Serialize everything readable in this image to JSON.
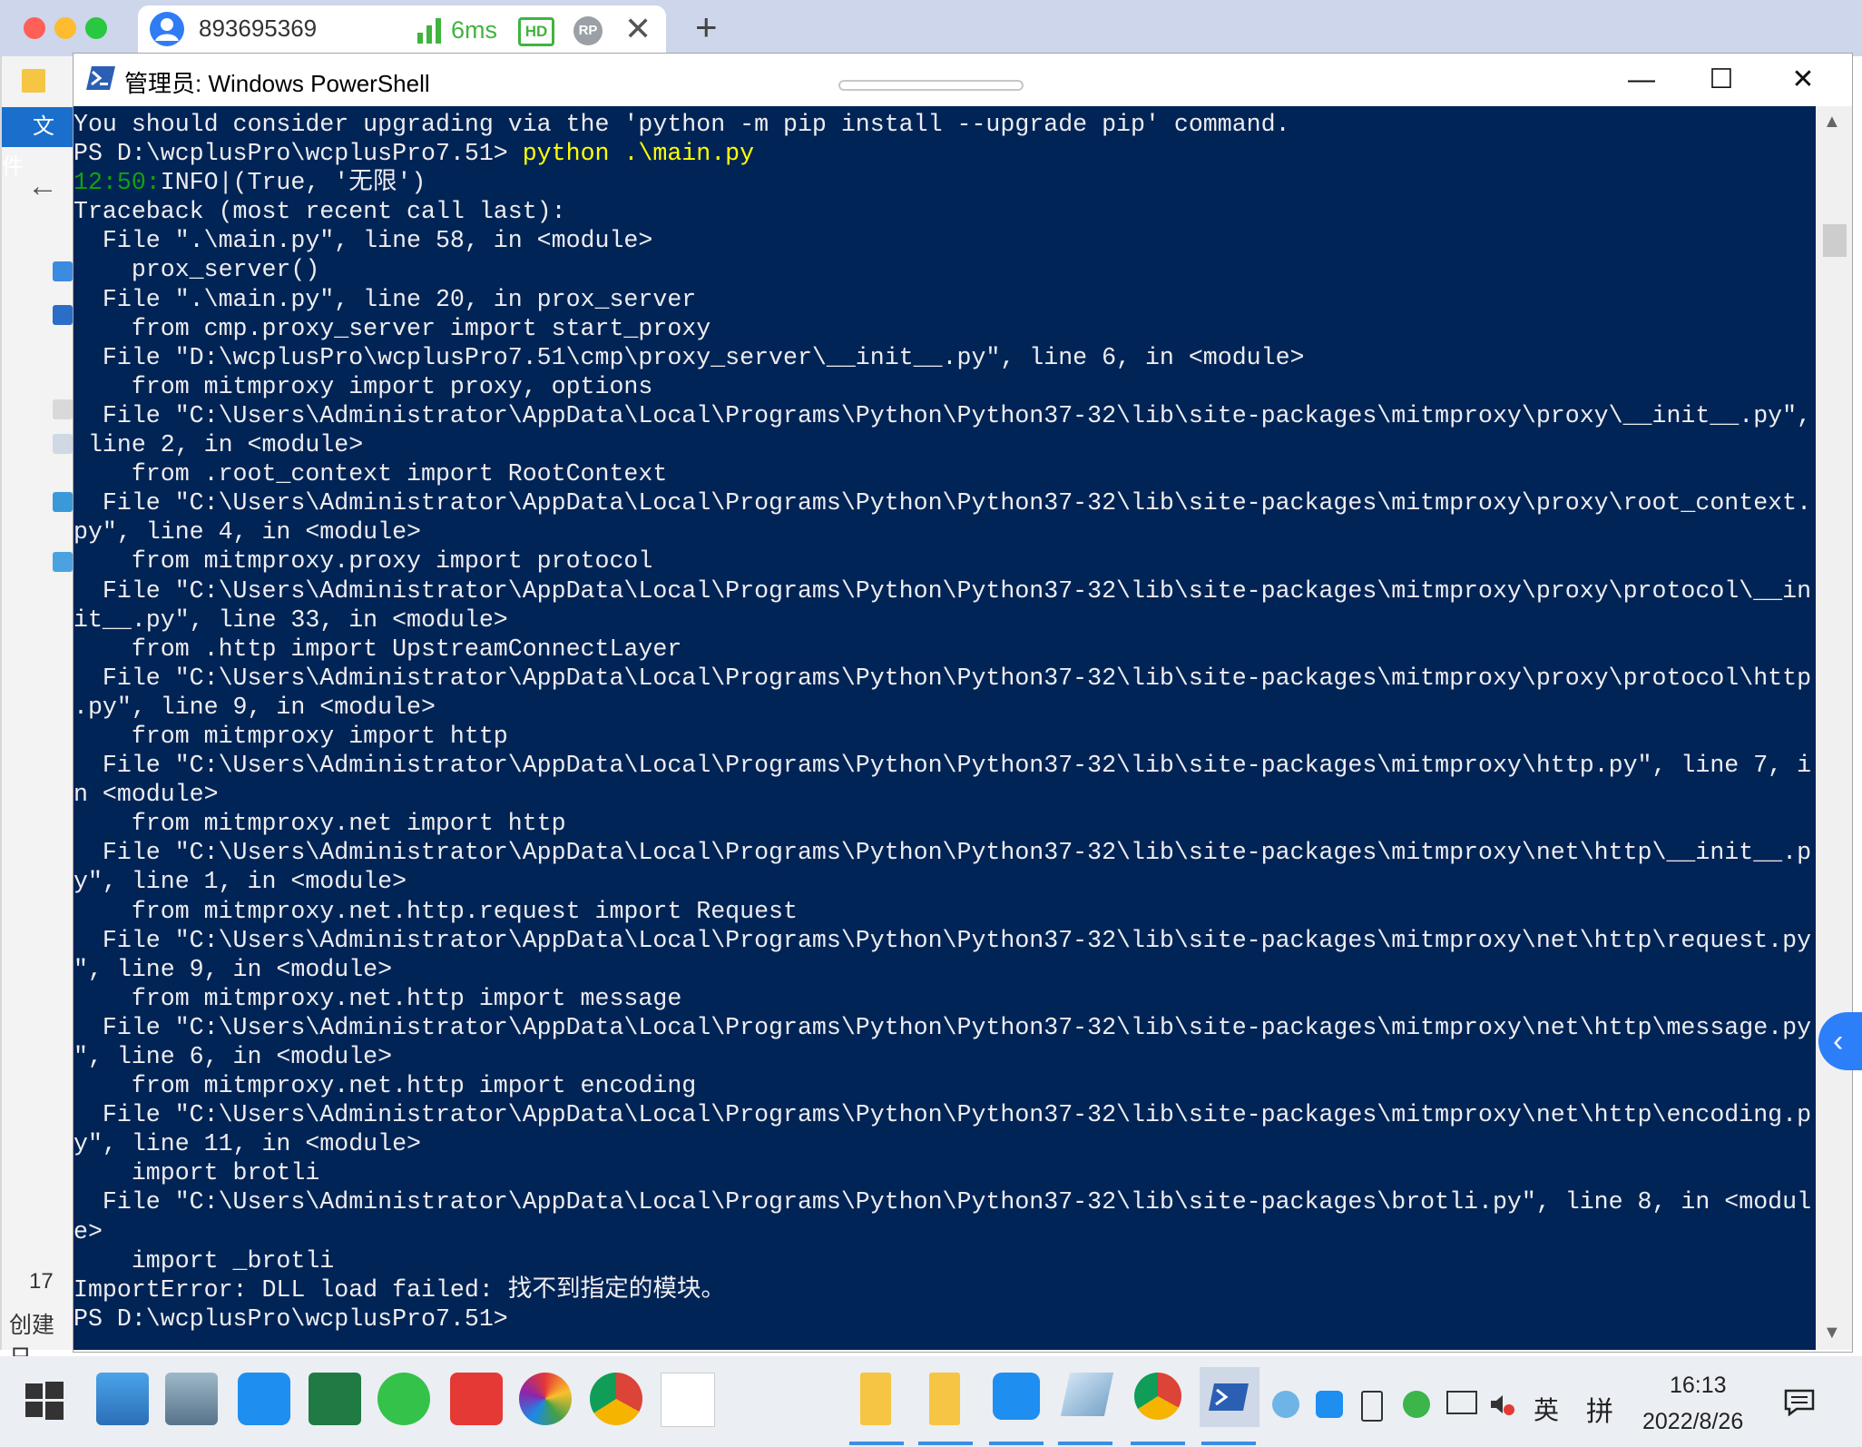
{
  "client": {
    "session_id": "893695369",
    "latency": "6ms",
    "hd_badge": "HD",
    "rp_badge": "RP",
    "close_tab": "✕",
    "new_tab": "+"
  },
  "explorer": {
    "file_tab": "文件",
    "back_arrow": "←",
    "item_count": "17",
    "status_text": "创建日"
  },
  "powershell": {
    "title": "管理员: Windows PowerShell",
    "minimize": "—",
    "maximize": "☐",
    "close": "✕",
    "colors": {
      "background": "#012456",
      "text": "#eeedf0",
      "command": "#ffff00",
      "timestamp": "#13a10e"
    },
    "console": {
      "line_0": "You should consider upgrading via the 'python -m pip install --upgrade pip' command.",
      "line_1_prompt": "PS D:\\wcplusPro\\wcplusPro7.51> ",
      "line_1_cmd": "python .\\main.py",
      "line_2_time": "12:50:",
      "line_2_rest": "INFO|(True, '无限')",
      "line_3": "Traceback (most recent call last):",
      "line_4": "  File \".\\main.py\", line 58, in <module>",
      "line_5": "    prox_server()",
      "line_6": "  File \".\\main.py\", line 20, in prox_server",
      "line_7": "    from cmp.proxy_server import start_proxy",
      "line_8": "  File \"D:\\wcplusPro\\wcplusPro7.51\\cmp\\proxy_server\\__init__.py\", line 6, in <module>",
      "line_9": "    from mitmproxy import proxy, options",
      "line_10": "  File \"C:\\Users\\Administrator\\AppData\\Local\\Programs\\Python\\Python37-32\\lib\\site-packages\\mitmproxy\\proxy\\__init__.py\",",
      "line_11": " line 2, in <module>",
      "line_12": "    from .root_context import RootContext",
      "line_13": "  File \"C:\\Users\\Administrator\\AppData\\Local\\Programs\\Python\\Python37-32\\lib\\site-packages\\mitmproxy\\proxy\\root_context.",
      "line_14": "py\", line 4, in <module>",
      "line_15": "    from mitmproxy.proxy import protocol",
      "line_16": "  File \"C:\\Users\\Administrator\\AppData\\Local\\Programs\\Python\\Python37-32\\lib\\site-packages\\mitmproxy\\proxy\\protocol\\__in",
      "line_17": "it__.py\", line 33, in <module>",
      "line_18": "    from .http import UpstreamConnectLayer",
      "line_19": "  File \"C:\\Users\\Administrator\\AppData\\Local\\Programs\\Python\\Python37-32\\lib\\site-packages\\mitmproxy\\proxy\\protocol\\http",
      "line_20": ".py\", line 9, in <module>",
      "line_21": "    from mitmproxy import http",
      "line_22": "  File \"C:\\Users\\Administrator\\AppData\\Local\\Programs\\Python\\Python37-32\\lib\\site-packages\\mitmproxy\\http.py\", line 7, i",
      "line_23": "n <module>",
      "line_24": "    from mitmproxy.net import http",
      "line_25": "  File \"C:\\Users\\Administrator\\AppData\\Local\\Programs\\Python\\Python37-32\\lib\\site-packages\\mitmproxy\\net\\http\\__init__.p",
      "line_26": "y\", line 1, in <module>",
      "line_27": "    from mitmproxy.net.http.request import Request",
      "line_28": "  File \"C:\\Users\\Administrator\\AppData\\Local\\Programs\\Python\\Python37-32\\lib\\site-packages\\mitmproxy\\net\\http\\request.py",
      "line_29": "\", line 9, in <module>",
      "line_30": "    from mitmproxy.net.http import message",
      "line_31": "  File \"C:\\Users\\Administrator\\AppData\\Local\\Programs\\Python\\Python37-32\\lib\\site-packages\\mitmproxy\\net\\http\\message.py",
      "line_32": "\", line 6, in <module>",
      "line_33": "    from mitmproxy.net.http import encoding",
      "line_34": "  File \"C:\\Users\\Administrator\\AppData\\Local\\Programs\\Python\\Python37-32\\lib\\site-packages\\mitmproxy\\net\\http\\encoding.p",
      "line_35": "y\", line 11, in <module>",
      "line_36": "    import brotli",
      "line_37": "  File \"C:\\Users\\Administrator\\AppData\\Local\\Programs\\Python\\Python37-32\\lib\\site-packages\\brotli.py\", line 8, in <modul",
      "line_38": "e>",
      "line_39": "    import _brotli",
      "line_40": "ImportError: DLL load failed: 找不到指定的模块。",
      "line_41": "PS D:\\wcplusPro\\wcplusPro7.51>"
    }
  },
  "taskbar": {
    "language": "英",
    "ime": "拼",
    "time": "16:13",
    "date": "2022/8/26",
    "icons": [
      "windows-start-icon",
      "computer-icon",
      "photo-viewer-icon",
      "teamviewer-icon",
      "excel-icon",
      "wechat-icon",
      "xmind-icon",
      "browser-ring-icon",
      "chrome-icon",
      "blank-app-icon",
      "folder-icon",
      "folder-icon",
      "teamviewer-icon",
      "note-icon",
      "chrome-icon",
      "powershell-icon"
    ]
  }
}
